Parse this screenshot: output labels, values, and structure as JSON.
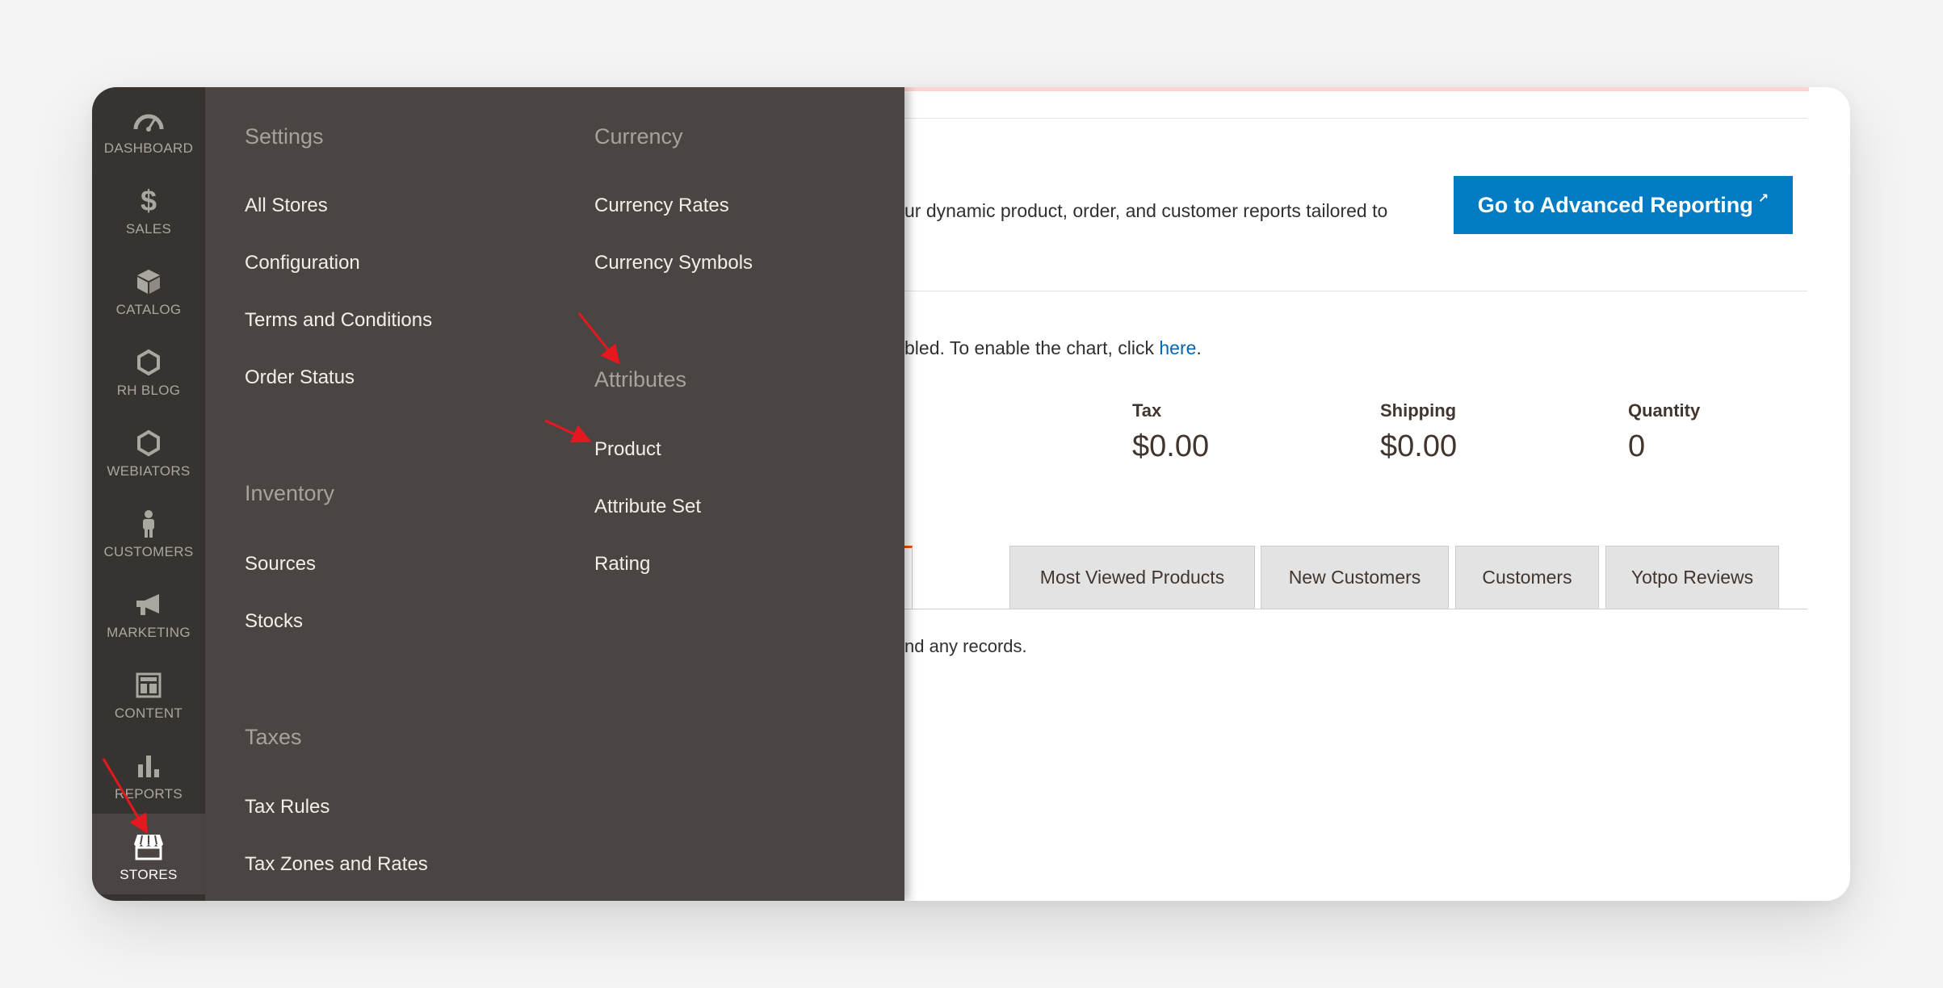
{
  "nav": {
    "items": [
      {
        "label": "DASHBOARD",
        "icon": "dashboard-gauge-icon"
      },
      {
        "label": "SALES",
        "icon": "dollar-icon"
      },
      {
        "label": "CATALOG",
        "icon": "box-icon"
      },
      {
        "label": "RH BLOG",
        "icon": "hexagon-icon"
      },
      {
        "label": "WEBIATORS",
        "icon": "hexagon-icon"
      },
      {
        "label": "CUSTOMERS",
        "icon": "person-icon"
      },
      {
        "label": "MARKETING",
        "icon": "megaphone-icon"
      },
      {
        "label": "CONTENT",
        "icon": "layout-icon"
      },
      {
        "label": "REPORTS",
        "icon": "bar-chart-icon"
      },
      {
        "label": "STORES",
        "icon": "storefront-icon",
        "active": true
      }
    ]
  },
  "flyout": {
    "settings": {
      "title": "Settings",
      "links": [
        "All Stores",
        "Configuration",
        "Terms and Conditions",
        "Order Status"
      ]
    },
    "inventory": {
      "title": "Inventory",
      "links": [
        "Sources",
        "Stocks"
      ]
    },
    "taxes": {
      "title": "Taxes",
      "links": [
        "Tax Rules",
        "Tax Zones and Rates"
      ]
    },
    "currency": {
      "title": "Currency",
      "links": [
        "Currency Rates",
        "Currency Symbols"
      ]
    },
    "attributes": {
      "title": "Attributes",
      "links": [
        "Product",
        "Attribute Set",
        "Rating"
      ]
    }
  },
  "main": {
    "advanced_text": "ur dynamic product, order, and customer reports tailored to",
    "advanced_button": "Go to Advanced Reporting",
    "chart_text": "bled. To enable the chart, click ",
    "chart_link": "here",
    "chart_end": ".",
    "stats": [
      {
        "label": "Tax",
        "value": "$0.00"
      },
      {
        "label": "Shipping",
        "value": "$0.00"
      },
      {
        "label": "Quantity",
        "value": "0"
      }
    ],
    "tabs": [
      "Most Viewed Products",
      "New Customers",
      "Customers",
      "Yotpo Reviews"
    ],
    "records_text": "nd any records."
  },
  "colors": {
    "nav_bg": "#373330",
    "flyout_bg": "#4a4542",
    "button_blue": "#007bc4",
    "annotation_red": "#e4181e"
  }
}
